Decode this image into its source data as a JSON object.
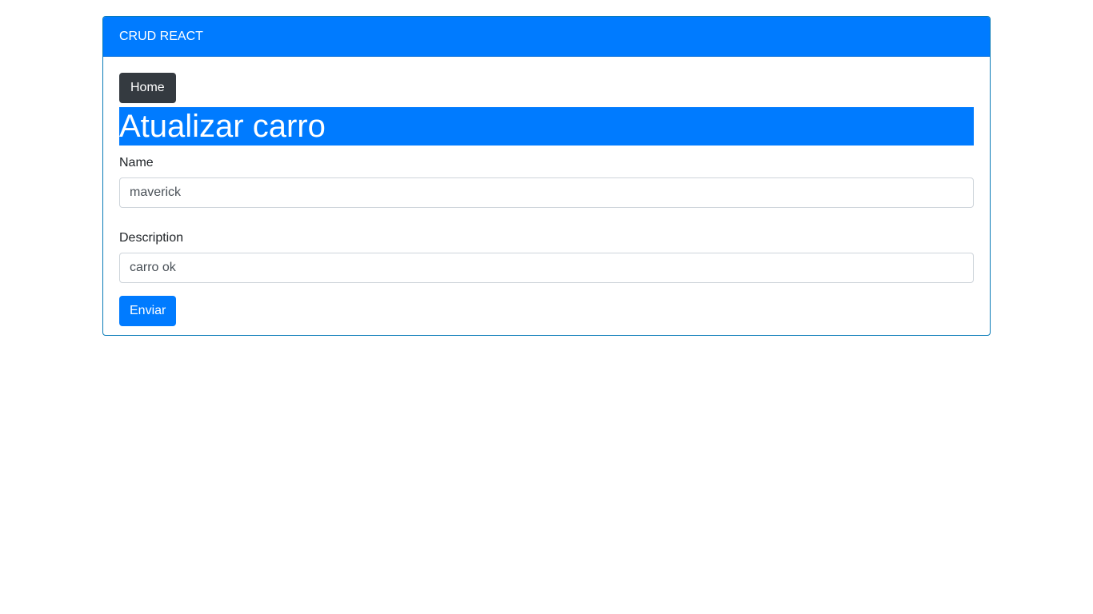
{
  "header": {
    "title": "CRUD REACT"
  },
  "nav": {
    "home_label": "Home"
  },
  "page": {
    "heading": "Atualizar carro"
  },
  "form": {
    "name_label": "Name",
    "name_value": "maverick",
    "description_label": "Description",
    "description_value": "carro ok",
    "submit_label": "Enviar"
  },
  "colors": {
    "primary": "#007bff",
    "dark": "#343a40",
    "card_border": "#0a7bb8"
  }
}
